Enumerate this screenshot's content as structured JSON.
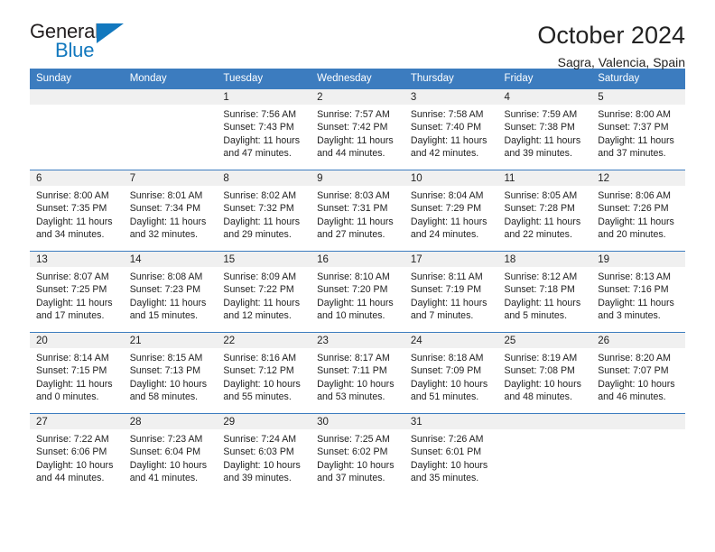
{
  "logo": {
    "word_top": "General",
    "word_bottom": "Blue",
    "triangle_color": "#1278be"
  },
  "header": {
    "title": "October 2024",
    "subtitle": "Sagra, Valencia, Spain"
  },
  "theme": {
    "header_blue": "#3c7cbf",
    "daynum_bg": "#f0f0f0",
    "text": "#222222"
  },
  "labels": {
    "sunrise_prefix": "Sunrise:",
    "sunset_prefix": "Sunset:",
    "daylight_prefix": "Daylight:"
  },
  "weekday_headers": [
    "Sunday",
    "Monday",
    "Tuesday",
    "Wednesday",
    "Thursday",
    "Friday",
    "Saturday"
  ],
  "weeks": [
    [
      {
        "day": "",
        "sunrise": "",
        "sunset": "",
        "daylight_line1": "",
        "daylight_line2": ""
      },
      {
        "day": "",
        "sunrise": "",
        "sunset": "",
        "daylight_line1": "",
        "daylight_line2": ""
      },
      {
        "day": "1",
        "sunrise": "Sunrise: 7:56 AM",
        "sunset": "Sunset: 7:43 PM",
        "daylight_line1": "Daylight: 11 hours",
        "daylight_line2": "and 47 minutes."
      },
      {
        "day": "2",
        "sunrise": "Sunrise: 7:57 AM",
        "sunset": "Sunset: 7:42 PM",
        "daylight_line1": "Daylight: 11 hours",
        "daylight_line2": "and 44 minutes."
      },
      {
        "day": "3",
        "sunrise": "Sunrise: 7:58 AM",
        "sunset": "Sunset: 7:40 PM",
        "daylight_line1": "Daylight: 11 hours",
        "daylight_line2": "and 42 minutes."
      },
      {
        "day": "4",
        "sunrise": "Sunrise: 7:59 AM",
        "sunset": "Sunset: 7:38 PM",
        "daylight_line1": "Daylight: 11 hours",
        "daylight_line2": "and 39 minutes."
      },
      {
        "day": "5",
        "sunrise": "Sunrise: 8:00 AM",
        "sunset": "Sunset: 7:37 PM",
        "daylight_line1": "Daylight: 11 hours",
        "daylight_line2": "and 37 minutes."
      }
    ],
    [
      {
        "day": "6",
        "sunrise": "Sunrise: 8:00 AM",
        "sunset": "Sunset: 7:35 PM",
        "daylight_line1": "Daylight: 11 hours",
        "daylight_line2": "and 34 minutes."
      },
      {
        "day": "7",
        "sunrise": "Sunrise: 8:01 AM",
        "sunset": "Sunset: 7:34 PM",
        "daylight_line1": "Daylight: 11 hours",
        "daylight_line2": "and 32 minutes."
      },
      {
        "day": "8",
        "sunrise": "Sunrise: 8:02 AM",
        "sunset": "Sunset: 7:32 PM",
        "daylight_line1": "Daylight: 11 hours",
        "daylight_line2": "and 29 minutes."
      },
      {
        "day": "9",
        "sunrise": "Sunrise: 8:03 AM",
        "sunset": "Sunset: 7:31 PM",
        "daylight_line1": "Daylight: 11 hours",
        "daylight_line2": "and 27 minutes."
      },
      {
        "day": "10",
        "sunrise": "Sunrise: 8:04 AM",
        "sunset": "Sunset: 7:29 PM",
        "daylight_line1": "Daylight: 11 hours",
        "daylight_line2": "and 24 minutes."
      },
      {
        "day": "11",
        "sunrise": "Sunrise: 8:05 AM",
        "sunset": "Sunset: 7:28 PM",
        "daylight_line1": "Daylight: 11 hours",
        "daylight_line2": "and 22 minutes."
      },
      {
        "day": "12",
        "sunrise": "Sunrise: 8:06 AM",
        "sunset": "Sunset: 7:26 PM",
        "daylight_line1": "Daylight: 11 hours",
        "daylight_line2": "and 20 minutes."
      }
    ],
    [
      {
        "day": "13",
        "sunrise": "Sunrise: 8:07 AM",
        "sunset": "Sunset: 7:25 PM",
        "daylight_line1": "Daylight: 11 hours",
        "daylight_line2": "and 17 minutes."
      },
      {
        "day": "14",
        "sunrise": "Sunrise: 8:08 AM",
        "sunset": "Sunset: 7:23 PM",
        "daylight_line1": "Daylight: 11 hours",
        "daylight_line2": "and 15 minutes."
      },
      {
        "day": "15",
        "sunrise": "Sunrise: 8:09 AM",
        "sunset": "Sunset: 7:22 PM",
        "daylight_line1": "Daylight: 11 hours",
        "daylight_line2": "and 12 minutes."
      },
      {
        "day": "16",
        "sunrise": "Sunrise: 8:10 AM",
        "sunset": "Sunset: 7:20 PM",
        "daylight_line1": "Daylight: 11 hours",
        "daylight_line2": "and 10 minutes."
      },
      {
        "day": "17",
        "sunrise": "Sunrise: 8:11 AM",
        "sunset": "Sunset: 7:19 PM",
        "daylight_line1": "Daylight: 11 hours",
        "daylight_line2": "and 7 minutes."
      },
      {
        "day": "18",
        "sunrise": "Sunrise: 8:12 AM",
        "sunset": "Sunset: 7:18 PM",
        "daylight_line1": "Daylight: 11 hours",
        "daylight_line2": "and 5 minutes."
      },
      {
        "day": "19",
        "sunrise": "Sunrise: 8:13 AM",
        "sunset": "Sunset: 7:16 PM",
        "daylight_line1": "Daylight: 11 hours",
        "daylight_line2": "and 3 minutes."
      }
    ],
    [
      {
        "day": "20",
        "sunrise": "Sunrise: 8:14 AM",
        "sunset": "Sunset: 7:15 PM",
        "daylight_line1": "Daylight: 11 hours",
        "daylight_line2": "and 0 minutes."
      },
      {
        "day": "21",
        "sunrise": "Sunrise: 8:15 AM",
        "sunset": "Sunset: 7:13 PM",
        "daylight_line1": "Daylight: 10 hours",
        "daylight_line2": "and 58 minutes."
      },
      {
        "day": "22",
        "sunrise": "Sunrise: 8:16 AM",
        "sunset": "Sunset: 7:12 PM",
        "daylight_line1": "Daylight: 10 hours",
        "daylight_line2": "and 55 minutes."
      },
      {
        "day": "23",
        "sunrise": "Sunrise: 8:17 AM",
        "sunset": "Sunset: 7:11 PM",
        "daylight_line1": "Daylight: 10 hours",
        "daylight_line2": "and 53 minutes."
      },
      {
        "day": "24",
        "sunrise": "Sunrise: 8:18 AM",
        "sunset": "Sunset: 7:09 PM",
        "daylight_line1": "Daylight: 10 hours",
        "daylight_line2": "and 51 minutes."
      },
      {
        "day": "25",
        "sunrise": "Sunrise: 8:19 AM",
        "sunset": "Sunset: 7:08 PM",
        "daylight_line1": "Daylight: 10 hours",
        "daylight_line2": "and 48 minutes."
      },
      {
        "day": "26",
        "sunrise": "Sunrise: 8:20 AM",
        "sunset": "Sunset: 7:07 PM",
        "daylight_line1": "Daylight: 10 hours",
        "daylight_line2": "and 46 minutes."
      }
    ],
    [
      {
        "day": "27",
        "sunrise": "Sunrise: 7:22 AM",
        "sunset": "Sunset: 6:06 PM",
        "daylight_line1": "Daylight: 10 hours",
        "daylight_line2": "and 44 minutes."
      },
      {
        "day": "28",
        "sunrise": "Sunrise: 7:23 AM",
        "sunset": "Sunset: 6:04 PM",
        "daylight_line1": "Daylight: 10 hours",
        "daylight_line2": "and 41 minutes."
      },
      {
        "day": "29",
        "sunrise": "Sunrise: 7:24 AM",
        "sunset": "Sunset: 6:03 PM",
        "daylight_line1": "Daylight: 10 hours",
        "daylight_line2": "and 39 minutes."
      },
      {
        "day": "30",
        "sunrise": "Sunrise: 7:25 AM",
        "sunset": "Sunset: 6:02 PM",
        "daylight_line1": "Daylight: 10 hours",
        "daylight_line2": "and 37 minutes."
      },
      {
        "day": "31",
        "sunrise": "Sunrise: 7:26 AM",
        "sunset": "Sunset: 6:01 PM",
        "daylight_line1": "Daylight: 10 hours",
        "daylight_line2": "and 35 minutes."
      },
      {
        "day": "",
        "sunrise": "",
        "sunset": "",
        "daylight_line1": "",
        "daylight_line2": ""
      },
      {
        "day": "",
        "sunrise": "",
        "sunset": "",
        "daylight_line1": "",
        "daylight_line2": ""
      }
    ]
  ]
}
